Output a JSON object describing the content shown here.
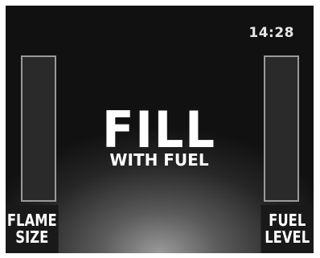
{
  "status": {
    "clock": "14:28"
  },
  "message": {
    "headline": "FILL",
    "subline": "WITH FUEL"
  },
  "gauges": {
    "flame_size": {
      "label_line1": "FLAME",
      "label_line2": "SIZE",
      "level": 0
    },
    "fuel_level": {
      "label_line1": "FUEL",
      "label_line2": "LEVEL",
      "level": 0
    }
  }
}
